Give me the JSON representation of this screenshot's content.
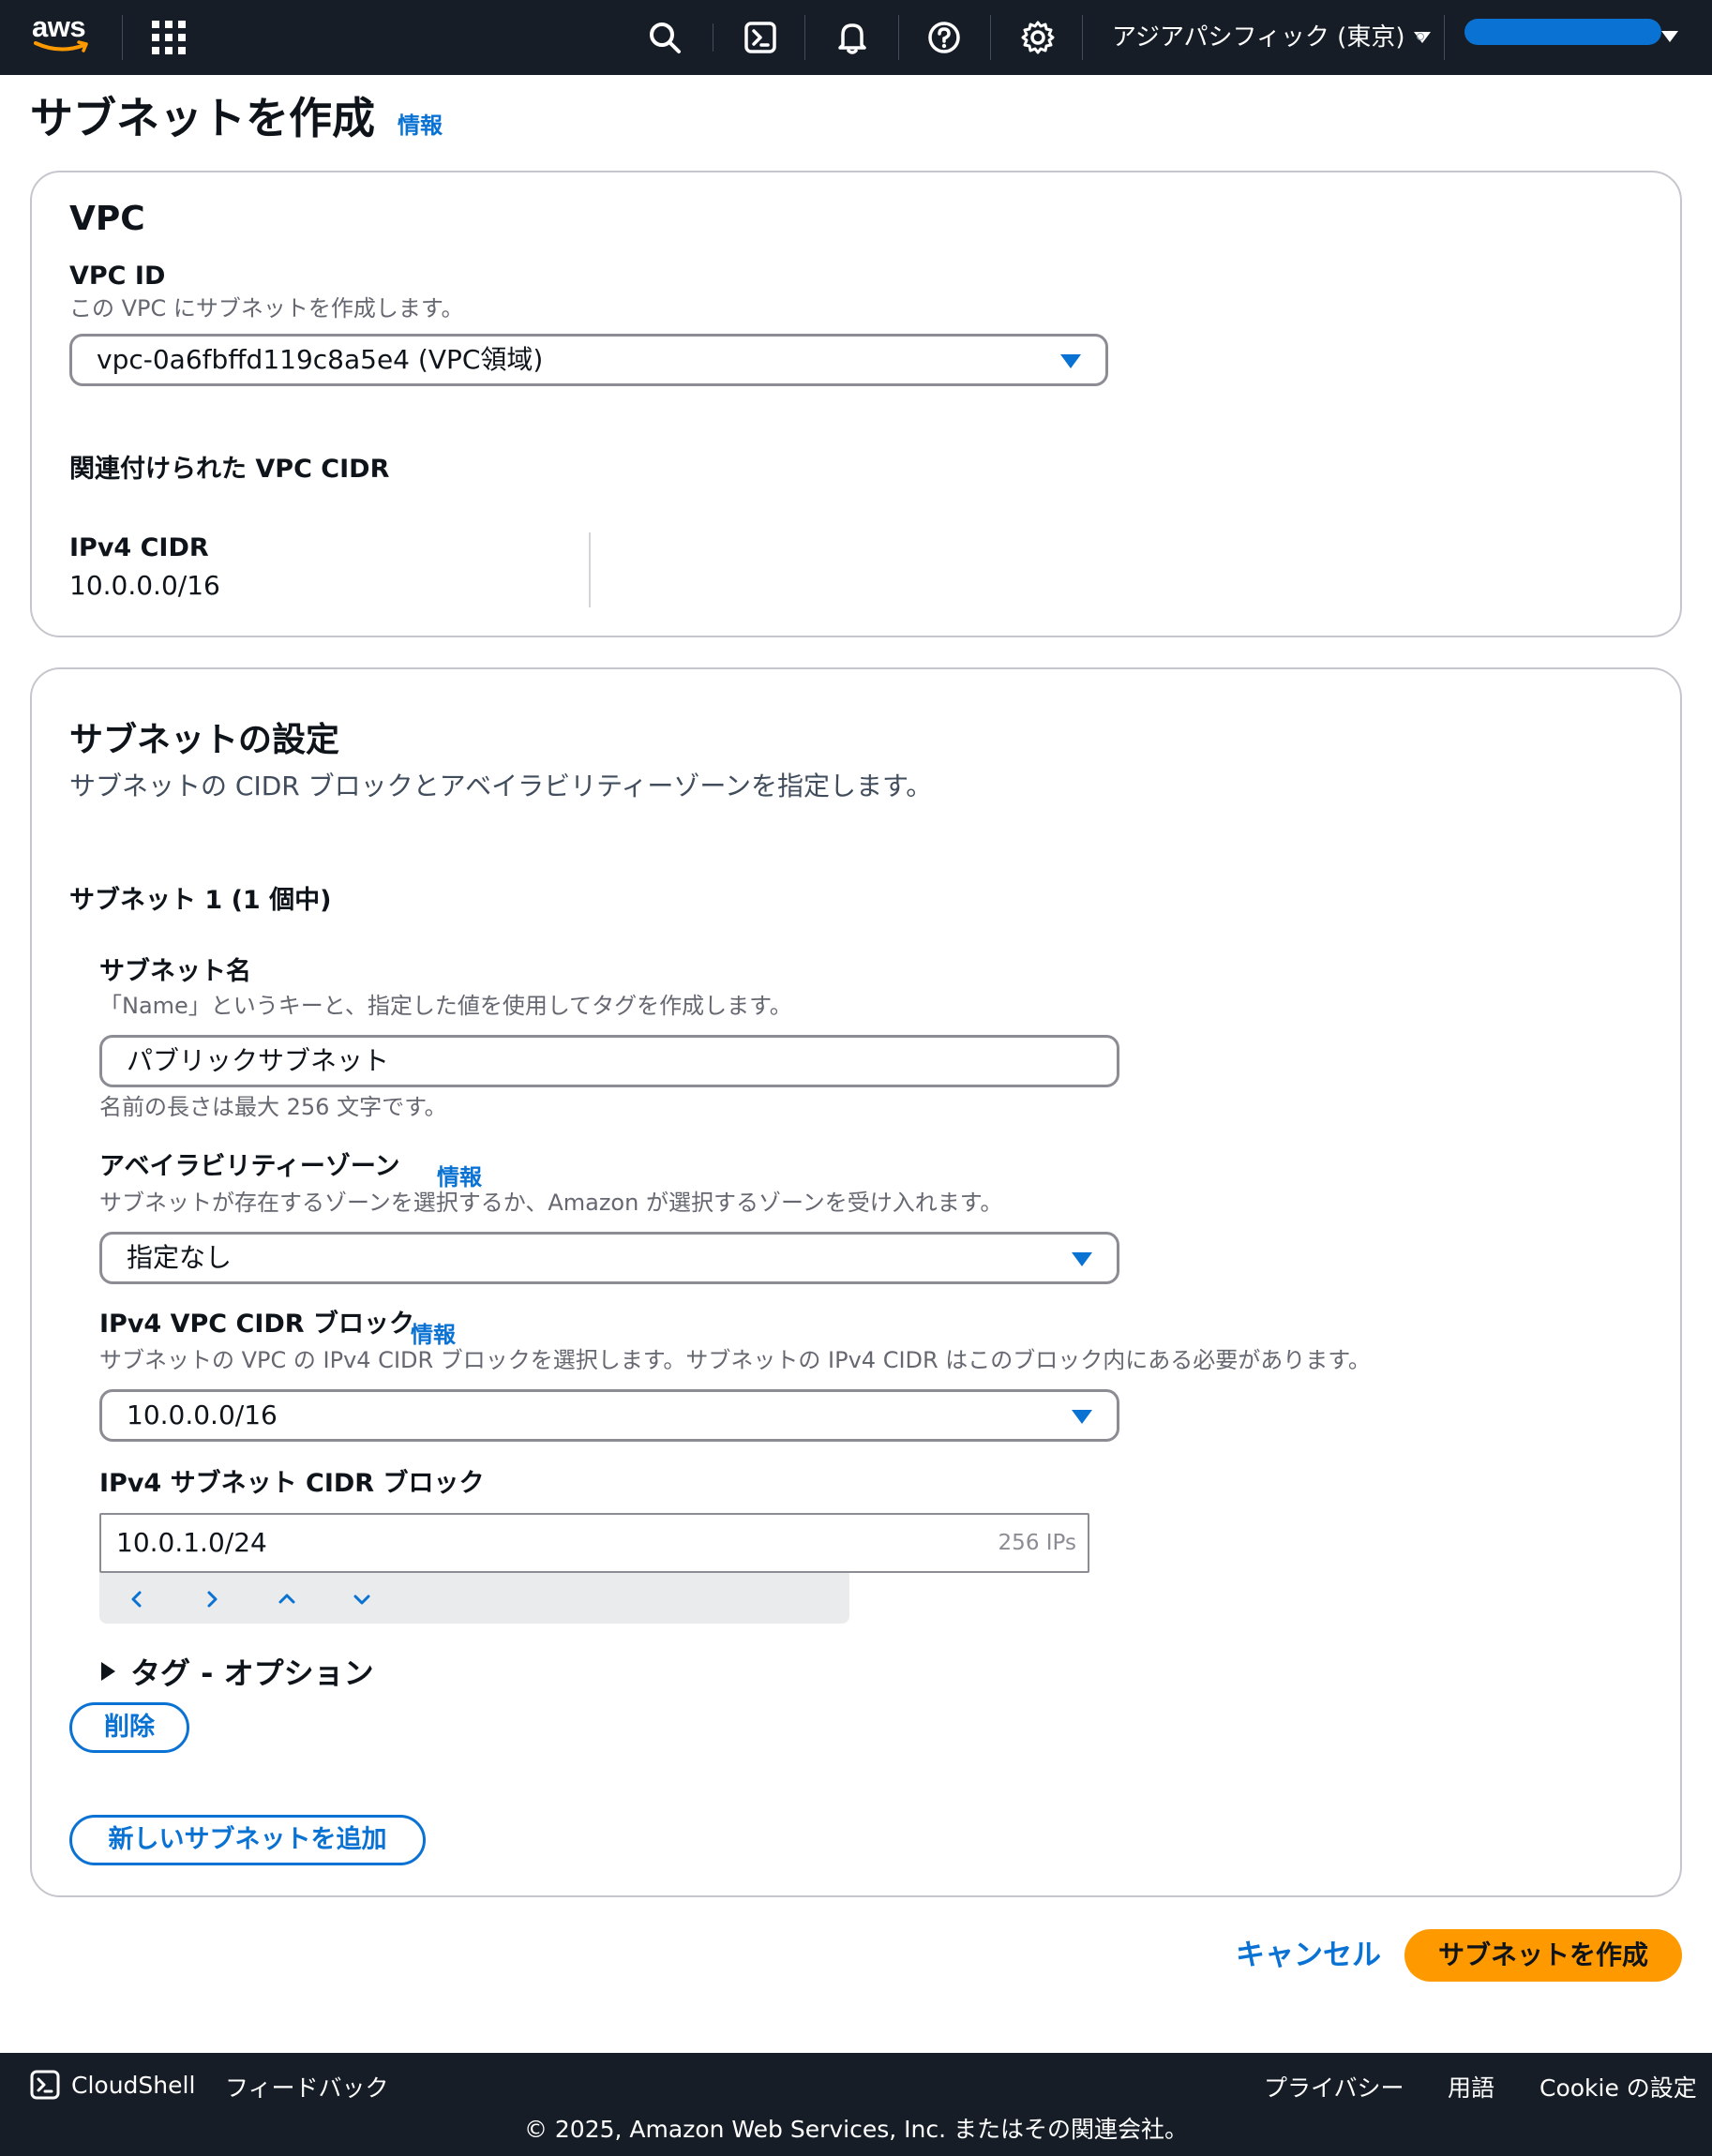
{
  "topnav": {
    "logo_text": "aws",
    "region": "アジアパシフィック (東京)",
    "icons": [
      "search-icon",
      "cloudshell-icon",
      "bell-icon",
      "help-icon",
      "gear-icon"
    ]
  },
  "page": {
    "title": "サブネットを作成",
    "info": "情報"
  },
  "vpc": {
    "heading": "VPC",
    "vpc_id_label": "VPC ID",
    "vpc_id_desc": "この VPC にサブネットを作成します。",
    "vpc_id_value": "vpc-0a6fbffd119c8a5e4 (VPC領域)",
    "assoc_cidr_heading": "関連付けられた VPC CIDR",
    "ipv4_cidr_label": "IPv4 CIDR",
    "ipv4_cidr_value": "10.0.0.0/16"
  },
  "subnet_settings": {
    "heading": "サブネットの設定",
    "desc": "サブネットの CIDR ブロックとアベイラビリティーゾーンを指定します。",
    "subnet_counter": "サブネット 1 (1 個中)",
    "name_label": "サブネット名",
    "name_desc": "「Name」というキーと、指定した値を使用してタグを作成します。",
    "name_value": "パブリックサブネット",
    "name_constraint": "名前の長さは最大 256 文字です。",
    "az_label": "アベイラビリティーゾーン",
    "az_info": "情報",
    "az_desc": "サブネットが存在するゾーンを選択するか、Amazon が選択するゾーンを受け入れます。",
    "az_value": "指定なし",
    "vpc_cidr_label": "IPv4 VPC CIDR ブロック",
    "vpc_cidr_info": "情報",
    "vpc_cidr_desc": "サブネットの VPC の IPv4 CIDR ブロックを選択します。サブネットの IPv4 CIDR はこのブロック内にある必要があります。",
    "vpc_cidr_value": "10.0.0.0/16",
    "subnet_cidr_label": "IPv4 サブネット CIDR ブロック",
    "subnet_cidr_value": "10.0.1.0/24",
    "subnet_cidr_ip_count": "256 IPs",
    "tags_label": "タグ - オプション",
    "remove_button": "削除",
    "add_subnet_button": "新しいサブネットを追加"
  },
  "actions": {
    "cancel": "キャンセル",
    "create": "サブネットを作成"
  },
  "footer": {
    "cloudshell": "CloudShell",
    "feedback": "フィードバック",
    "privacy": "プライバシー",
    "terms": "用語",
    "cookie": "Cookie の設定",
    "copyright": "© 2025, Amazon Web Services, Inc. またはその関連会社。"
  },
  "colors": {
    "nav_bg": "#161d26",
    "link_blue": "#0972d3",
    "primary_orange": "#ff9900",
    "border_gray": "#8c8c94"
  }
}
